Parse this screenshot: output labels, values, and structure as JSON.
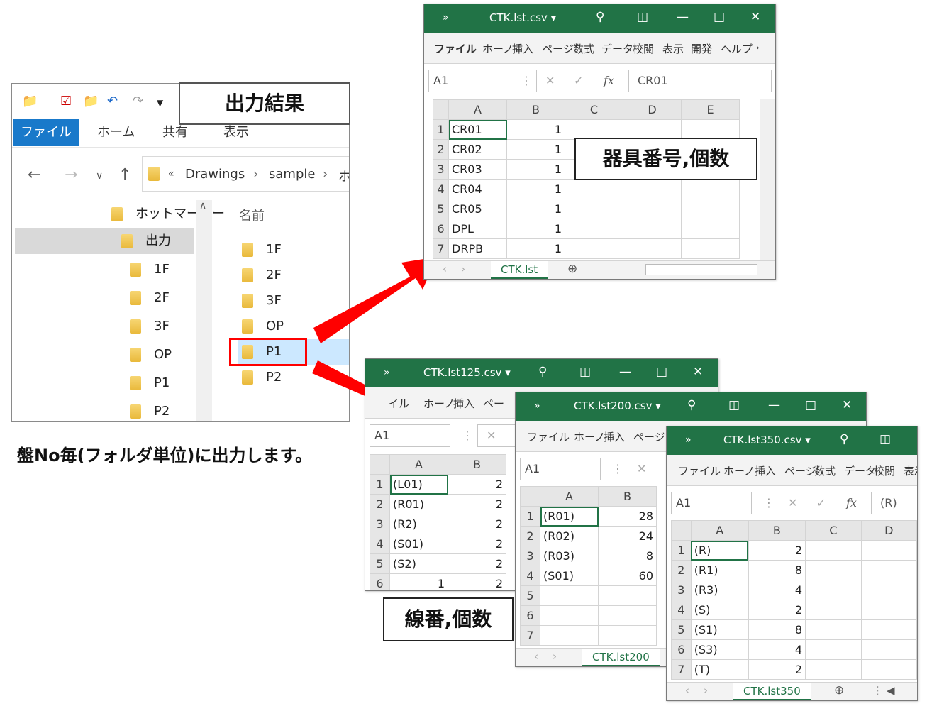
{
  "explorer": {
    "ribbon_tabs": [
      "ファイル",
      "ホーム",
      "共有",
      "表示"
    ],
    "crumbs": [
      "«",
      "Drawings",
      "›",
      "sample",
      "›",
      "ホ"
    ],
    "tree": [
      "ホットマーカー",
      "出力",
      "1F",
      "2F",
      "3F",
      "OP",
      "P1",
      "P2"
    ],
    "list_header": "名前",
    "list": [
      "1F",
      "2F",
      "3F",
      "OP",
      "P1",
      "P2"
    ]
  },
  "callouts": {
    "output": "出力結果",
    "device": "器具番号,個数",
    "wire": "線番,個数"
  },
  "note": "盤No毎(フォルダ単位)に出力します。",
  "xl_main": {
    "title": "CTK.lst.csv ▾",
    "tabs": [
      "ファイル",
      "ホーノ",
      "挿入",
      "ページ",
      "数式",
      "データ",
      "校閲",
      "表示",
      "開発",
      "ヘルプ"
    ],
    "namebox": "A1",
    "formula": "CR01",
    "cols": [
      "A",
      "B",
      "C",
      "D",
      "E"
    ],
    "rows": [
      [
        "1",
        "CR01",
        "1"
      ],
      [
        "2",
        "CR02",
        "1"
      ],
      [
        "3",
        "CR03",
        "1"
      ],
      [
        "4",
        "CR04",
        "1"
      ],
      [
        "5",
        "CR05",
        "1"
      ],
      [
        "6",
        "DPL",
        "1"
      ],
      [
        "7",
        "DRPB",
        "1"
      ]
    ],
    "sheet": "CTK.lst"
  },
  "xl_125": {
    "title": "CTK.lst125.csv ▾",
    "tabs": [
      "イル",
      "ホーノ",
      "挿入",
      "ペー"
    ],
    "namebox": "A1",
    "cols": [
      "A",
      "B"
    ],
    "rows": [
      [
        "1",
        "(L01)",
        "2"
      ],
      [
        "2",
        "(R01)",
        "2"
      ],
      [
        "3",
        "(R2)",
        "2"
      ],
      [
        "4",
        "(S01)",
        "2"
      ],
      [
        "5",
        "(S2)",
        "2"
      ],
      [
        "6",
        "1",
        "2"
      ]
    ]
  },
  "xl_200": {
    "title": "CTK.lst200.csv ▾",
    "tabs": [
      "ファイル",
      "ホーノ",
      "挿入",
      "ページ"
    ],
    "namebox": "A1",
    "cols": [
      "A",
      "B"
    ],
    "rows": [
      [
        "1",
        "(R01)",
        "28"
      ],
      [
        "2",
        "(R02)",
        "24"
      ],
      [
        "3",
        "(R03)",
        "8"
      ],
      [
        "4",
        "(S01)",
        "60"
      ],
      [
        "5",
        "",
        ""
      ],
      [
        "6",
        "",
        ""
      ],
      [
        "7",
        "",
        ""
      ]
    ],
    "sheet": "CTK.lst200"
  },
  "xl_350": {
    "title": "CTK.lst350.csv ▾",
    "tabs": [
      "ファイル",
      "ホーノ",
      "挿入",
      "ページ",
      "数式",
      "データ",
      "校閲",
      "表示"
    ],
    "namebox": "A1",
    "formula": "(R)",
    "cols": [
      "A",
      "B",
      "C",
      "D"
    ],
    "rows": [
      [
        "1",
        "(R)",
        "2"
      ],
      [
        "2",
        "(R1)",
        "8"
      ],
      [
        "3",
        "(R3)",
        "4"
      ],
      [
        "4",
        "(S)",
        "2"
      ],
      [
        "5",
        "(S1)",
        "8"
      ],
      [
        "6",
        "(S3)",
        "4"
      ],
      [
        "7",
        "(T)",
        "2"
      ]
    ],
    "sheet": "CTK.lst350"
  },
  "colors": {
    "excel_green": "#217346",
    "explorer_blue": "#1979ca",
    "arrow_red": "#ff0000",
    "highlight_red": "#ff0000"
  }
}
